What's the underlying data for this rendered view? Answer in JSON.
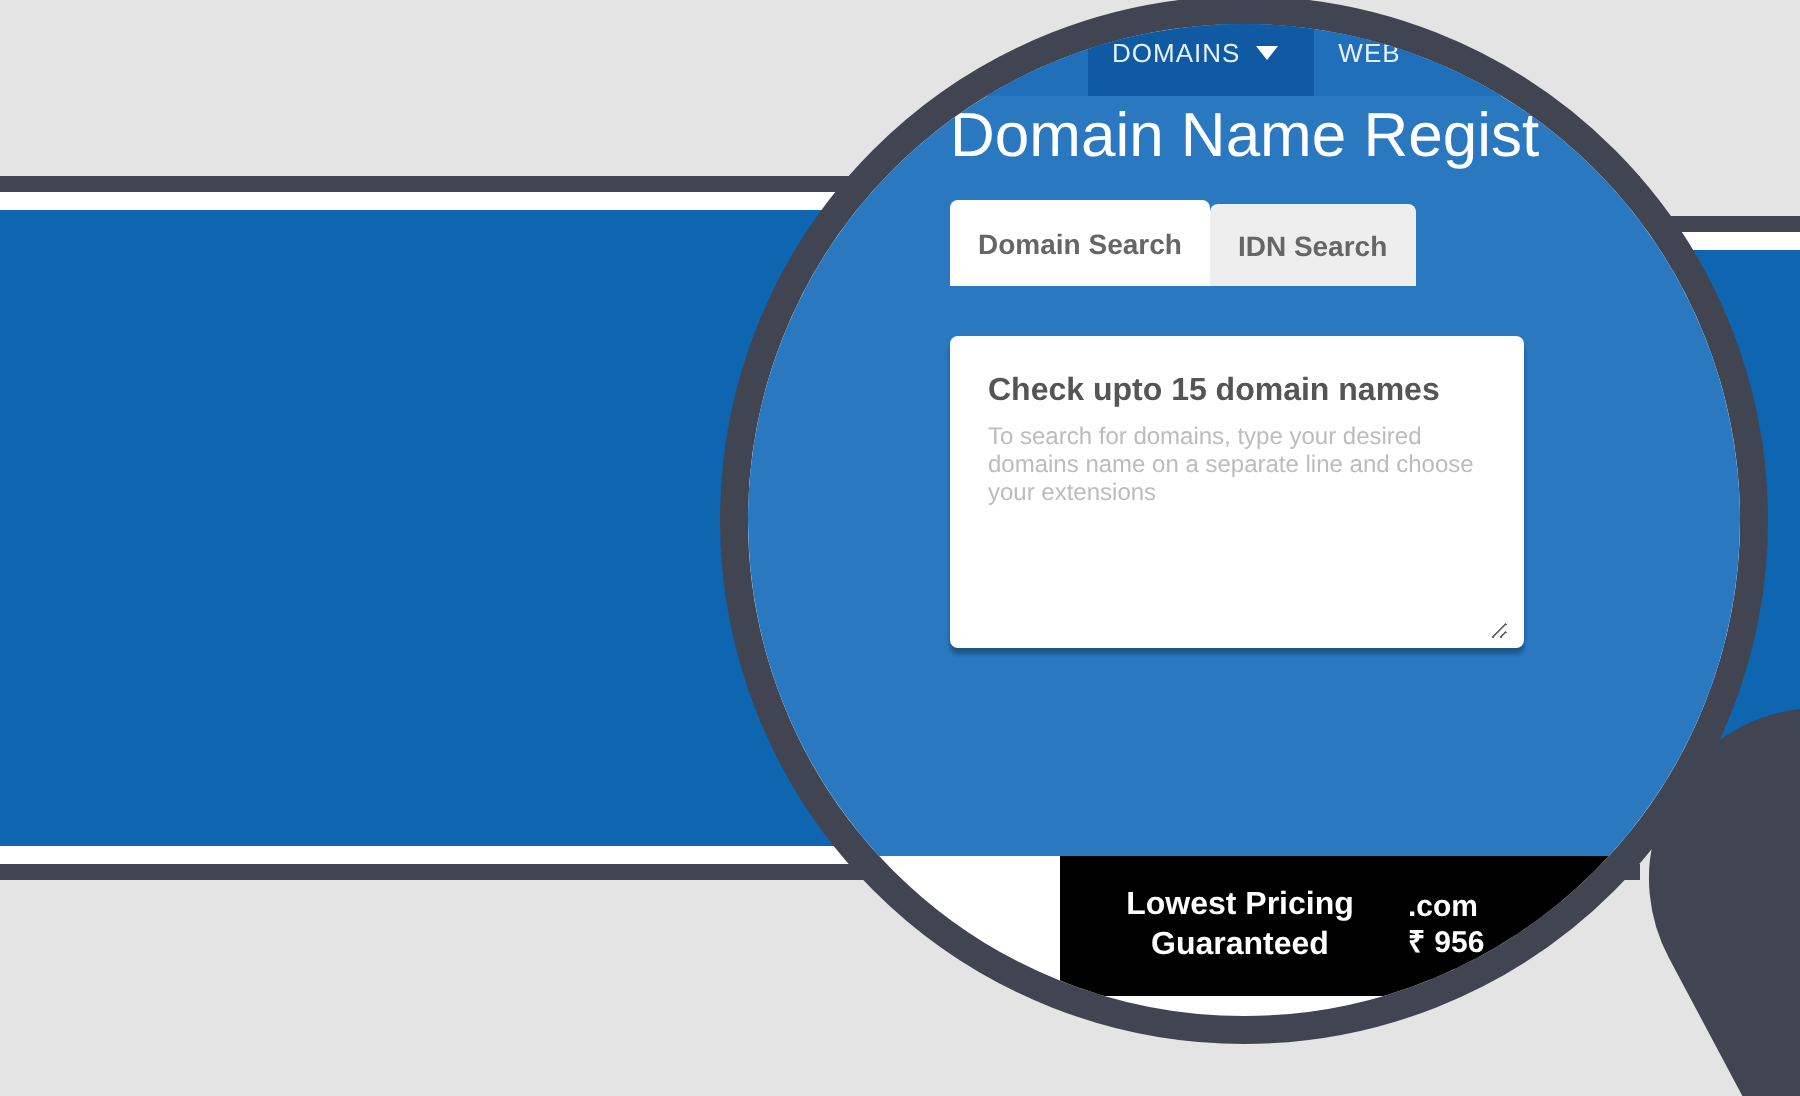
{
  "nav": {
    "items": [
      {
        "label": "DOMAINS",
        "selected": true,
        "dropdown": true
      },
      {
        "label": "WEB",
        "selected": false,
        "dropdown": false
      }
    ]
  },
  "page_title": "Domain Name Regist",
  "tabs": [
    {
      "label": "Domain Search",
      "selected": true
    },
    {
      "label": "IDN Search",
      "selected": false
    }
  ],
  "search_box": {
    "heading": "Check upto 15 domain names",
    "placeholder": "To search for domains, type your desired domains name on a separate line and choose your extensions"
  },
  "banner": {
    "tagline": "Lowest Pricing Guaranteed",
    "extension": ".com",
    "price": "₹ 956"
  }
}
